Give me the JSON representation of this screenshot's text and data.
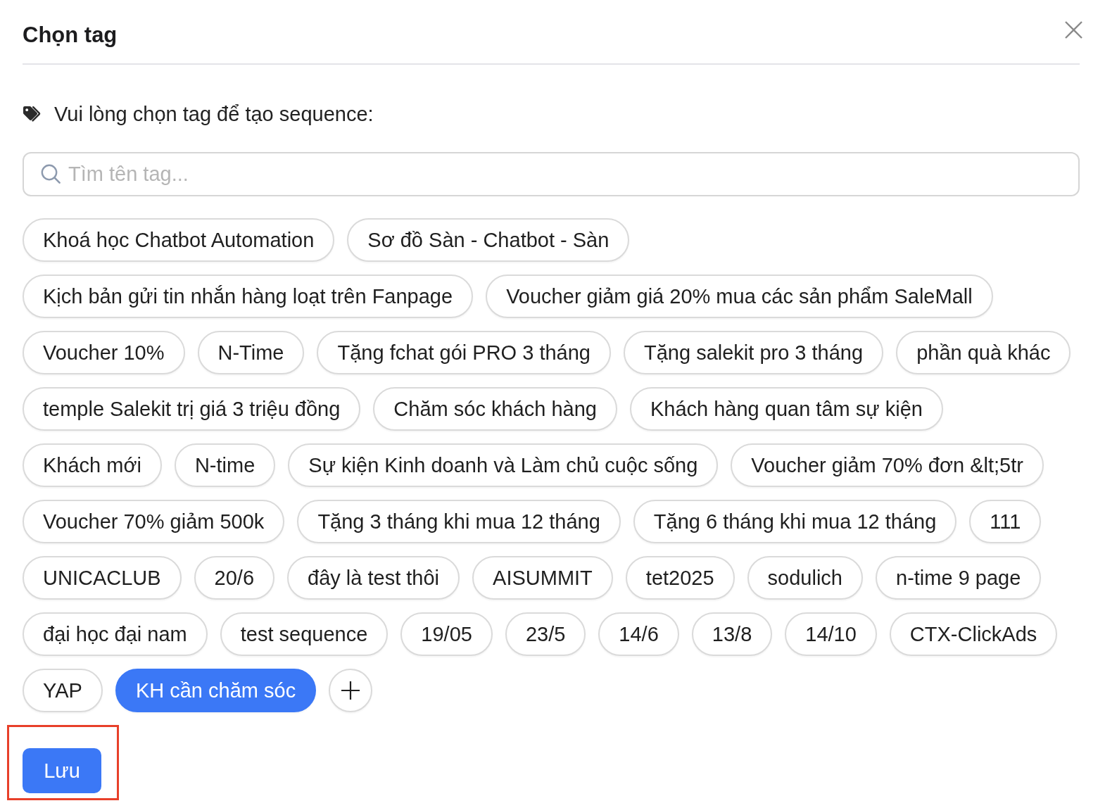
{
  "dialog": {
    "title": "Chọn tag",
    "instruction": "Vui lòng chọn tag để tạo sequence:",
    "search": {
      "placeholder": "Tìm tên tag..."
    },
    "tags": [
      {
        "label": "Khoá học Chatbot Automation",
        "selected": false
      },
      {
        "label": "Sơ đồ Sàn - Chatbot - Sàn",
        "selected": false
      },
      {
        "label": "Kịch bản gửi tin nhắn hàng loạt trên Fanpage",
        "selected": false
      },
      {
        "label": "Voucher giảm giá 20% mua các sản phẩm SaleMall",
        "selected": false
      },
      {
        "label": "Voucher 10%",
        "selected": false
      },
      {
        "label": "N-Time",
        "selected": false
      },
      {
        "label": "Tặng fchat gói PRO 3 tháng",
        "selected": false
      },
      {
        "label": "Tặng salekit pro 3 tháng",
        "selected": false
      },
      {
        "label": "phần quà khác",
        "selected": false
      },
      {
        "label": "temple Salekit trị giá 3 triệu đồng",
        "selected": false
      },
      {
        "label": "Chăm sóc khách hàng",
        "selected": false
      },
      {
        "label": "Khách hàng quan tâm sự kiện",
        "selected": false
      },
      {
        "label": "Khách mới",
        "selected": false
      },
      {
        "label": "N-time",
        "selected": false
      },
      {
        "label": "Sự kiện Kinh doanh và Làm chủ cuộc sống",
        "selected": false
      },
      {
        "label": "Voucher giảm 70% đơn &lt;5tr",
        "selected": false
      },
      {
        "label": "Voucher 70% giảm 500k",
        "selected": false
      },
      {
        "label": "Tặng 3 tháng khi mua 12 tháng",
        "selected": false
      },
      {
        "label": "Tặng 6 tháng khi mua 12 tháng",
        "selected": false
      },
      {
        "label": "111",
        "selected": false
      },
      {
        "label": "UNICACLUB",
        "selected": false
      },
      {
        "label": "20/6",
        "selected": false
      },
      {
        "label": "đây là test thôi",
        "selected": false
      },
      {
        "label": "AISUMMIT",
        "selected": false
      },
      {
        "label": "tet2025",
        "selected": false
      },
      {
        "label": "sodulich",
        "selected": false
      },
      {
        "label": "n-time 9 page",
        "selected": false
      },
      {
        "label": "đại học đại nam",
        "selected": false
      },
      {
        "label": "test sequence",
        "selected": false
      },
      {
        "label": "19/05",
        "selected": false
      },
      {
        "label": "23/5",
        "selected": false
      },
      {
        "label": "14/6",
        "selected": false
      },
      {
        "label": "13/8",
        "selected": false
      },
      {
        "label": "14/10",
        "selected": false
      },
      {
        "label": "CTX-ClickAds",
        "selected": false
      },
      {
        "label": "YAP",
        "selected": false
      },
      {
        "label": "KH cần chăm sóc",
        "selected": true
      }
    ],
    "save_button": {
      "label": "Lưu",
      "highlighted": true
    }
  }
}
